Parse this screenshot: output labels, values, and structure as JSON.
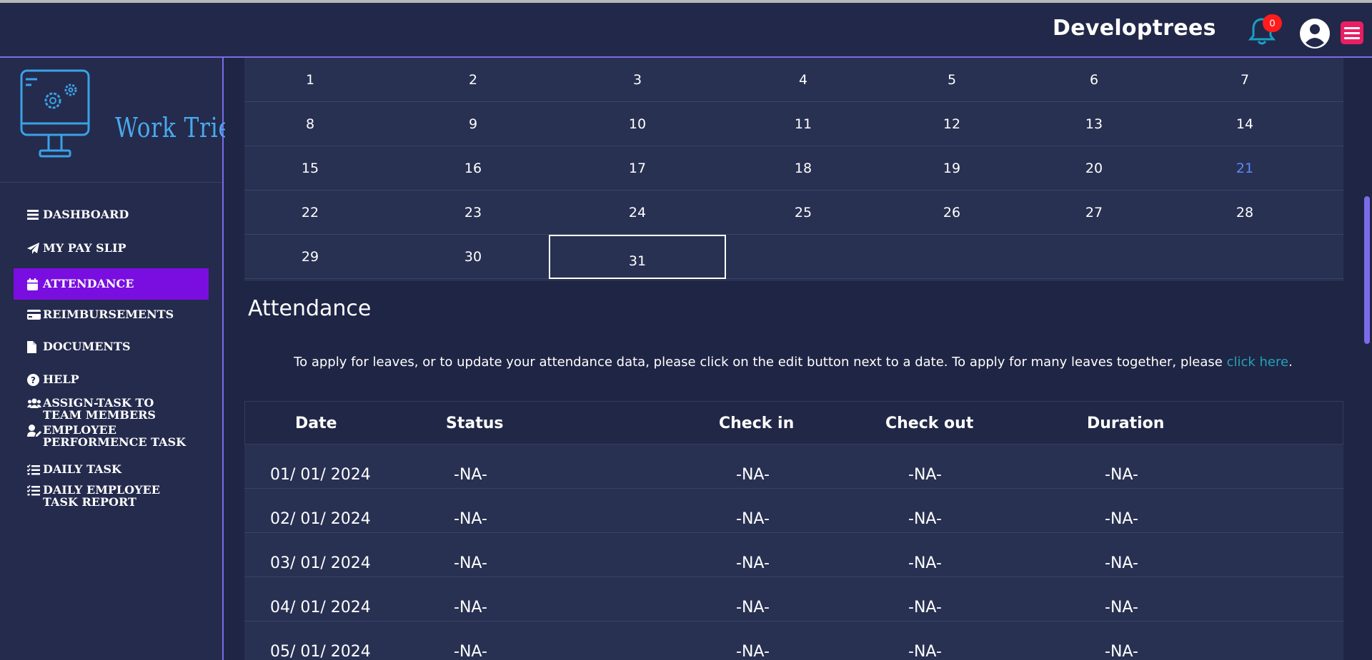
{
  "header": {
    "brand": "Developtrees",
    "notification_count": "0"
  },
  "sidebar": {
    "logo_text": "Work Tried",
    "items": [
      {
        "label": "DASHBOARD",
        "icon": "bars-icon"
      },
      {
        "label": "MY PAY SLIP",
        "icon": "paper-plane-icon"
      },
      {
        "label": "ATTENDANCE",
        "icon": "calendar-icon"
      },
      {
        "label": "REIMBURSEMENTS",
        "icon": "credit-card-icon"
      },
      {
        "label": "DOCUMENTS",
        "icon": "file-icon"
      },
      {
        "label": "HELP",
        "icon": "question-circle-icon"
      },
      {
        "label": "ASSIGN-TASK TO TEAM MEMBERS",
        "icon": "users-icon"
      },
      {
        "label": "EMPLOYEE PERFORMENCE TASK",
        "icon": "user-edit-icon"
      },
      {
        "label": "DAILY TASK",
        "icon": "list-check-icon"
      },
      {
        "label": "DAILY EMPLOYEE TASK REPORT",
        "icon": "list-check-icon"
      }
    ],
    "active_item": "ATTENDANCE"
  },
  "calendar": {
    "weeks": [
      [
        "1",
        "2",
        "3",
        "4",
        "5",
        "6",
        "7"
      ],
      [
        "8",
        "9",
        "10",
        "11",
        "12",
        "13",
        "14"
      ],
      [
        "15",
        "16",
        "17",
        "18",
        "19",
        "20",
        "21"
      ],
      [
        "22",
        "23",
        "24",
        "25",
        "26",
        "27",
        "28"
      ],
      [
        "29",
        "30",
        "31",
        "",
        "",
        "",
        ""
      ]
    ],
    "highlighted_day": "21",
    "selected_day": "31"
  },
  "attendance": {
    "title": "Attendance",
    "note_prefix": "To apply for leaves, or to update your attendance data, please click on the edit button next to a date. To apply for many leaves together, please ",
    "note_link": "click here",
    "note_suffix": ".",
    "columns": [
      "Date",
      "Status",
      "Check in",
      "Check out",
      "Duration"
    ],
    "rows": [
      {
        "date": "01/ 01/ 2024",
        "status": "-NA-",
        "check_in": "-NA-",
        "check_out": "-NA-",
        "duration": "-NA-"
      },
      {
        "date": "02/ 01/ 2024",
        "status": "-NA-",
        "check_in": "-NA-",
        "check_out": "-NA-",
        "duration": "-NA-"
      },
      {
        "date": "03/ 01/ 2024",
        "status": "-NA-",
        "check_in": "-NA-",
        "check_out": "-NA-",
        "duration": "-NA-"
      },
      {
        "date": "04/ 01/ 2024",
        "status": "-NA-",
        "check_in": "-NA-",
        "check_out": "-NA-",
        "duration": "-NA-"
      },
      {
        "date": "05/ 01/ 2024",
        "status": "-NA-",
        "check_in": "-NA-",
        "check_out": "-NA-",
        "duration": "-NA-"
      }
    ]
  },
  "colors": {
    "accent": "#7a0ee0",
    "border_accent": "#7b6bea",
    "link": "#24a3b7",
    "badge": "#ff1c1c",
    "menu_button": "#e91e63"
  }
}
